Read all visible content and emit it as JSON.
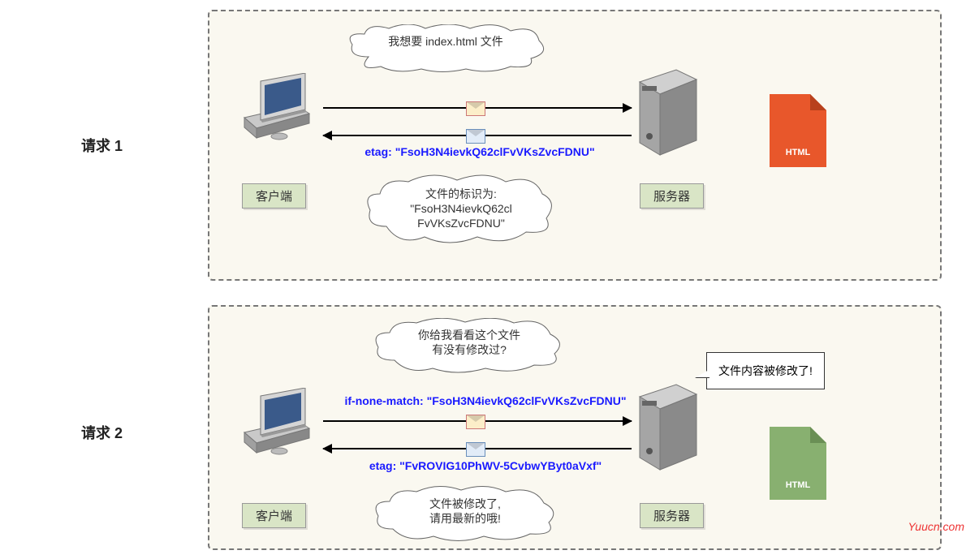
{
  "request1": {
    "title": "请求 1",
    "client_label": "客户端",
    "server_label": "服务器",
    "cloud_top": "我想要 index.html 文件",
    "header_line": "etag: \"FsoH3N4ievkQ62clFvVKsZvcFDNU\"",
    "cloud_bottom_line1": "文件的标识为:",
    "cloud_bottom_line2": "\"FsoH3N4ievkQ62cl",
    "cloud_bottom_line3": "FvVKsZvcFDNU\"",
    "file_badge": "HTML",
    "file_color": "#e8572b"
  },
  "request2": {
    "title": "请求 2",
    "client_label": "客户端",
    "server_label": "服务器",
    "cloud_top_line1": "你给我看看这个文件",
    "cloud_top_line2": "有没有修改过?",
    "header_line1": "if-none-match: \"FsoH3N4ievkQ62clFvVKsZvcFDNU\"",
    "header_line2": "etag: \"FvROVIG10PhWV-5CvbwYByt0aVxf\"",
    "cloud_bottom_line1": "文件被修改了,",
    "cloud_bottom_line2": "请用最新的哦!",
    "speech": "文件内容被修改了!",
    "file_badge": "HTML",
    "file_color": "#88b070"
  },
  "watermark": "Yuucn.com"
}
